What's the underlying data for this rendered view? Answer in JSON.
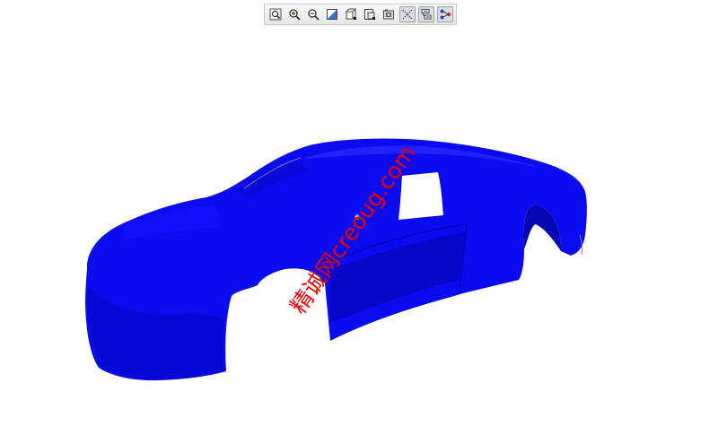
{
  "toolbar": {
    "buttons": [
      {
        "icon": "zoom-fit-icon",
        "active": false
      },
      {
        "icon": "zoom-in-icon",
        "active": false
      },
      {
        "icon": "zoom-out-icon",
        "active": false
      },
      {
        "icon": "repaint-icon",
        "active": false
      },
      {
        "icon": "display-style-icon",
        "active": false
      },
      {
        "icon": "saved-views-icon",
        "active": false
      },
      {
        "icon": "layers-icon",
        "active": false
      },
      {
        "icon": "datum-planes-icon",
        "active": true
      },
      {
        "icon": "datum-axes-icon",
        "active": true
      },
      {
        "icon": "datum-points-icon",
        "active": true
      }
    ]
  },
  "model": {
    "body_color": "#0b0bf0",
    "shade_color": "#0606b8",
    "highlight_color": "#3a3aff"
  },
  "watermark": {
    "text": "精诚网creoug.com",
    "color": "#e60000"
  }
}
